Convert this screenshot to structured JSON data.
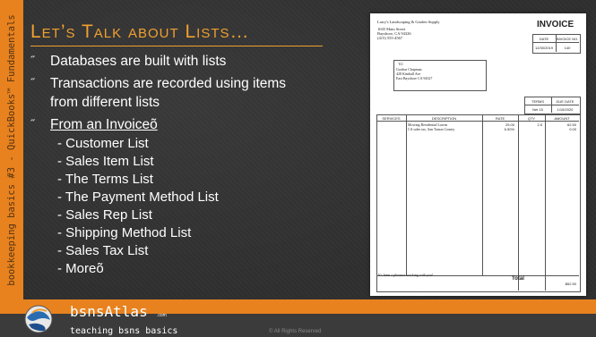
{
  "slide": {
    "title": "Let’s Talk about Lists…",
    "sidebar_text": "bookkeeping basics #3 - QuickBooks™ Fundamentals",
    "bullet_marker": "˝",
    "bullets": [
      "Databases are built with lists",
      "Transactions are recorded using items",
      "from different lists",
      "From an Invoiceõ"
    ],
    "sub_items": [
      "- Customer List",
      "- Sales Item List",
      "- The Terms List",
      "- The Payment Method List",
      "- Sales Rep List",
      "- Shipping Method List",
      "- Sales Tax List",
      "- Moreõ"
    ]
  },
  "invoice": {
    "company_name": "Larry's Landscaping & Garden Supply",
    "company_addr1": "1045 Main Street",
    "company_addr2": "Bayshore, CA 94326",
    "company_phone": "(415) 555-4567",
    "heading": "INVOICE",
    "date_label": "DATE",
    "invoice_no_label": "INVOICE NO.",
    "date_value": "12/30/2019",
    "invoice_no_value": "140",
    "to_label": "TO",
    "to_name": "Gordon Chapman",
    "to_addr1": "428 Kimball Ave",
    "to_addr2": "East Bayshore CA 94327",
    "terms_label": "TERMS",
    "due_date_label": "DUE DATE",
    "terms_value": "Net 15",
    "due_date_value": "1/15/2020",
    "col_services": "SERVICES",
    "col_description": "DESCRIPTION",
    "col_rate": "RATE",
    "col_qty": "QTY",
    "col_amount": "AMOUNT",
    "line1_desc": "Mowing Residential Lawns",
    "line1_rate": "25.00",
    "line1_qty": "2.5",
    "line1_amount": "62.50",
    "line2_desc": "CA sales tax, San Tomas County",
    "line2_rate": "6.50%",
    "line2_amount": "0.00",
    "footer_msg": "It's been a pleasure working with you!",
    "total_label": "Total",
    "total_value": "$62.50"
  },
  "footer": {
    "brand": "bsnsAtlas",
    "brand_suffix": ".com",
    "tagline": "teaching bsns basics",
    "copyright": "© All Rights Reserved"
  },
  "colors": {
    "accent_orange": "#e8821e",
    "title_orange": "#f0a030",
    "background": "#2f2f2f"
  }
}
